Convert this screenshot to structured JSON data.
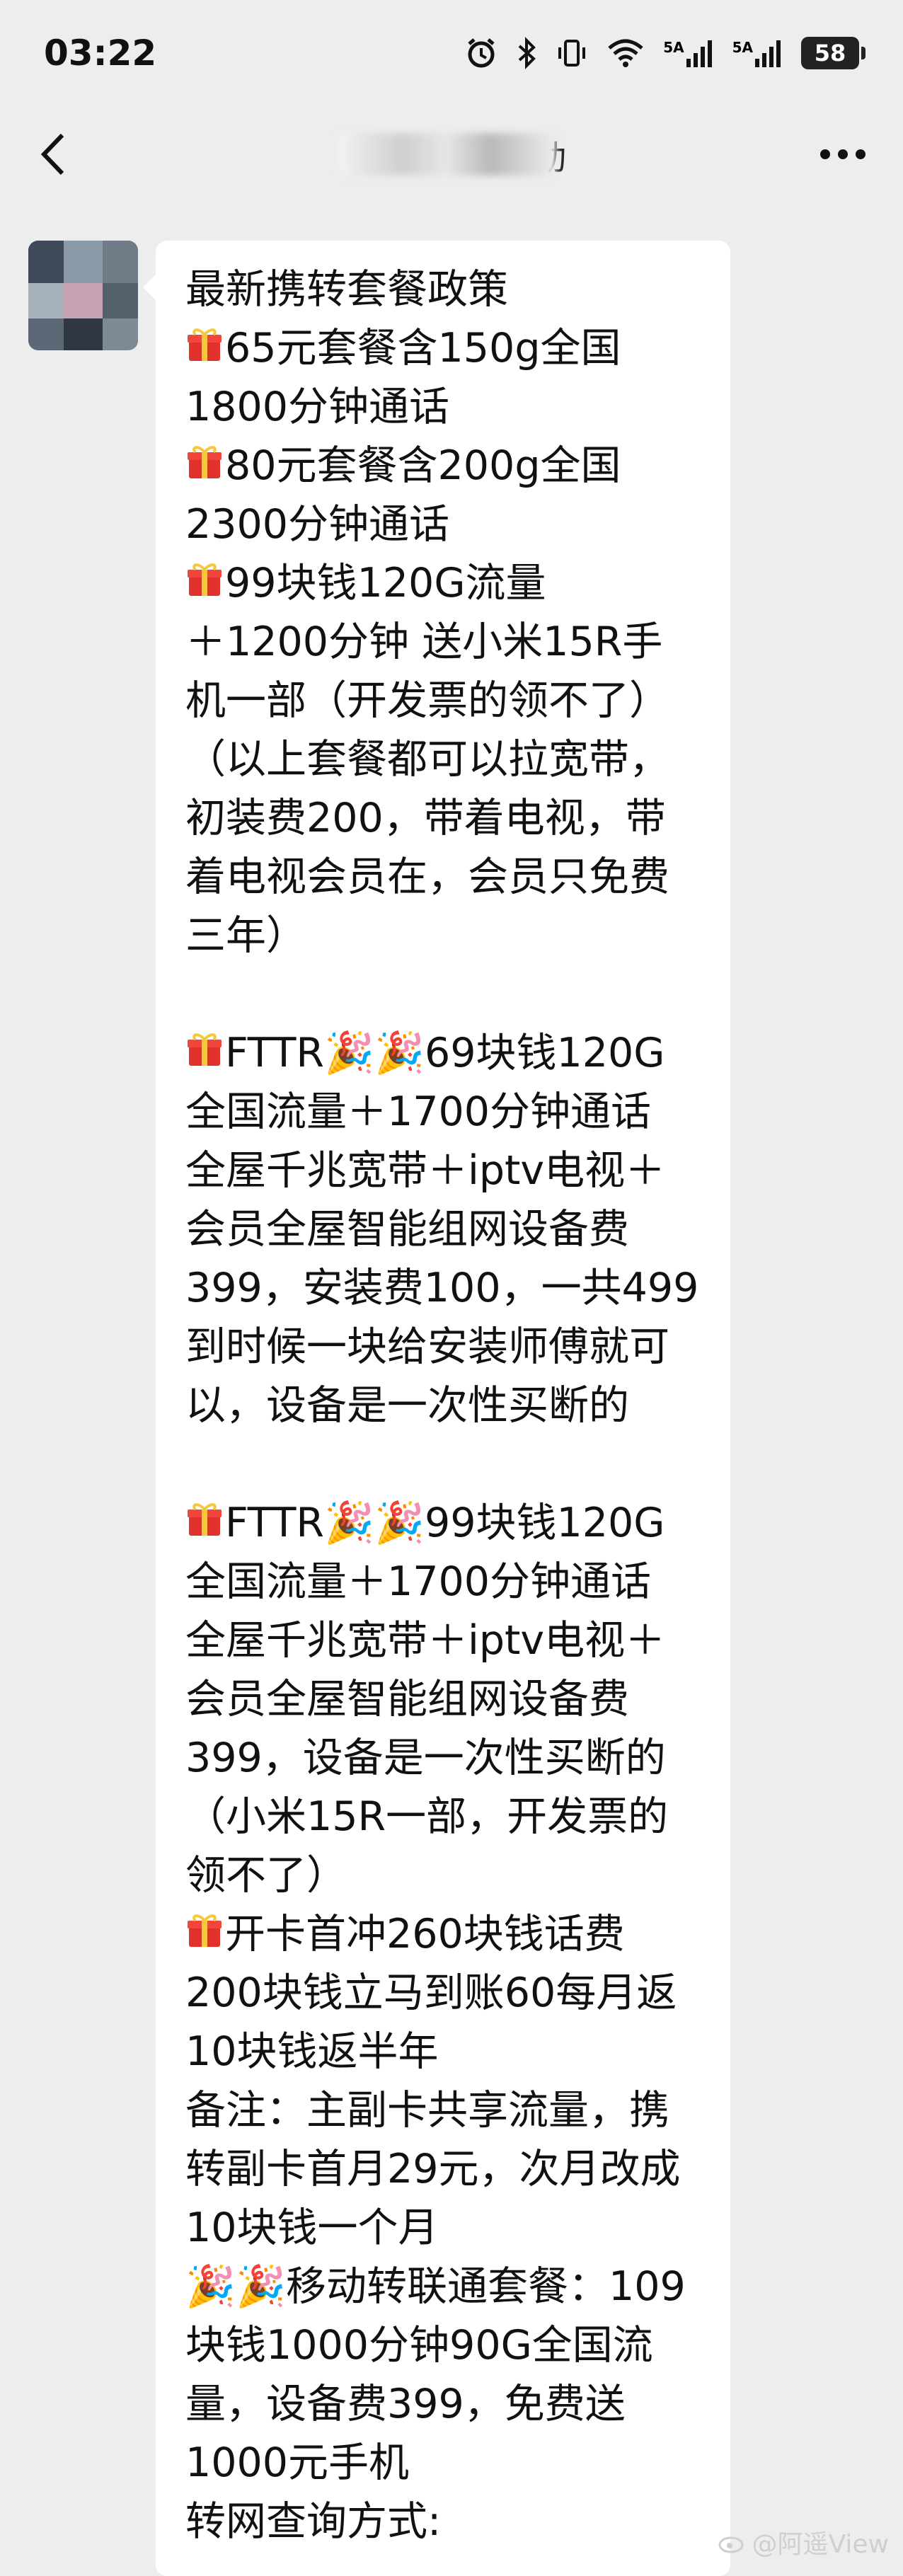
{
  "status_bar": {
    "time": "03:22",
    "network_1": "5A",
    "network_2": "5A",
    "battery": "58"
  },
  "nav": {
    "back_icon": "chevron-left-icon",
    "title_visible": "动",
    "more_icon": "more-dots-icon"
  },
  "message": {
    "lines": [
      {
        "emoji": "",
        "text": "最新携转套餐政策"
      },
      {
        "emoji": "gift",
        "text": "65元套餐含150g全国"
      },
      {
        "emoji": "",
        "text": "1800分钟通话"
      },
      {
        "emoji": "gift",
        "text": "80元套餐含200g全国"
      },
      {
        "emoji": "",
        "text": "2300分钟通话"
      },
      {
        "emoji": "gift",
        "text": "99块钱120G流量"
      },
      {
        "emoji": "",
        "text": "＋1200分钟 送小米15R手"
      },
      {
        "emoji": "",
        "text": "机一部（开发票的领不了）"
      },
      {
        "emoji": "",
        "text": "（以上套餐都可以拉宽带，"
      },
      {
        "emoji": "",
        "text": "初装费200，带着电视，带"
      },
      {
        "emoji": "",
        "text": "着电视会员在，会员只免费"
      },
      {
        "emoji": "",
        "text": "三年）"
      },
      {
        "emoji": "",
        "text": ""
      },
      {
        "emoji": "gift",
        "text": "FTTR🎉🎉69块钱120G"
      },
      {
        "emoji": "",
        "text": "全国流量＋1700分钟通话"
      },
      {
        "emoji": "",
        "text": "全屋千兆宽带＋iptv电视＋"
      },
      {
        "emoji": "",
        "text": "会员全屋智能组网设备费"
      },
      {
        "emoji": "",
        "text": "399，安装费100，一共499"
      },
      {
        "emoji": "",
        "text": "到时候一块给安装师傅就可"
      },
      {
        "emoji": "",
        "text": "以，设备是一次性买断的"
      },
      {
        "emoji": "",
        "text": ""
      },
      {
        "emoji": "gift",
        "text": "FTTR🎉🎉99块钱120G"
      },
      {
        "emoji": "",
        "text": "全国流量＋1700分钟通话"
      },
      {
        "emoji": "",
        "text": "全屋千兆宽带＋iptv电视＋"
      },
      {
        "emoji": "",
        "text": "会员全屋智能组网设备费"
      },
      {
        "emoji": "",
        "text": "399，设备是一次性买断的"
      },
      {
        "emoji": "",
        "text": "（小米15R一部，开发票的"
      },
      {
        "emoji": "",
        "text": "领不了）"
      },
      {
        "emoji": "gift",
        "text": "开卡首冲260块钱话费"
      },
      {
        "emoji": "",
        "text": "200块钱立马到账60每月返"
      },
      {
        "emoji": "",
        "text": "10块钱返半年"
      },
      {
        "emoji": "",
        "text": "备注：主副卡共享流量，携"
      },
      {
        "emoji": "",
        "text": "转副卡首月29元，次月改成"
      },
      {
        "emoji": "",
        "text": "10块钱一个月"
      },
      {
        "emoji": "",
        "text": "🎉🎉移动转联通套餐：109"
      },
      {
        "emoji": "",
        "text": "块钱1000分钟90G全国流"
      },
      {
        "emoji": "",
        "text": "量，设备费399，免费送"
      },
      {
        "emoji": "",
        "text": "1000元手机"
      },
      {
        "emoji": "",
        "text": "转网查询方式:"
      }
    ]
  },
  "watermark": {
    "text": "@阿遥View"
  }
}
